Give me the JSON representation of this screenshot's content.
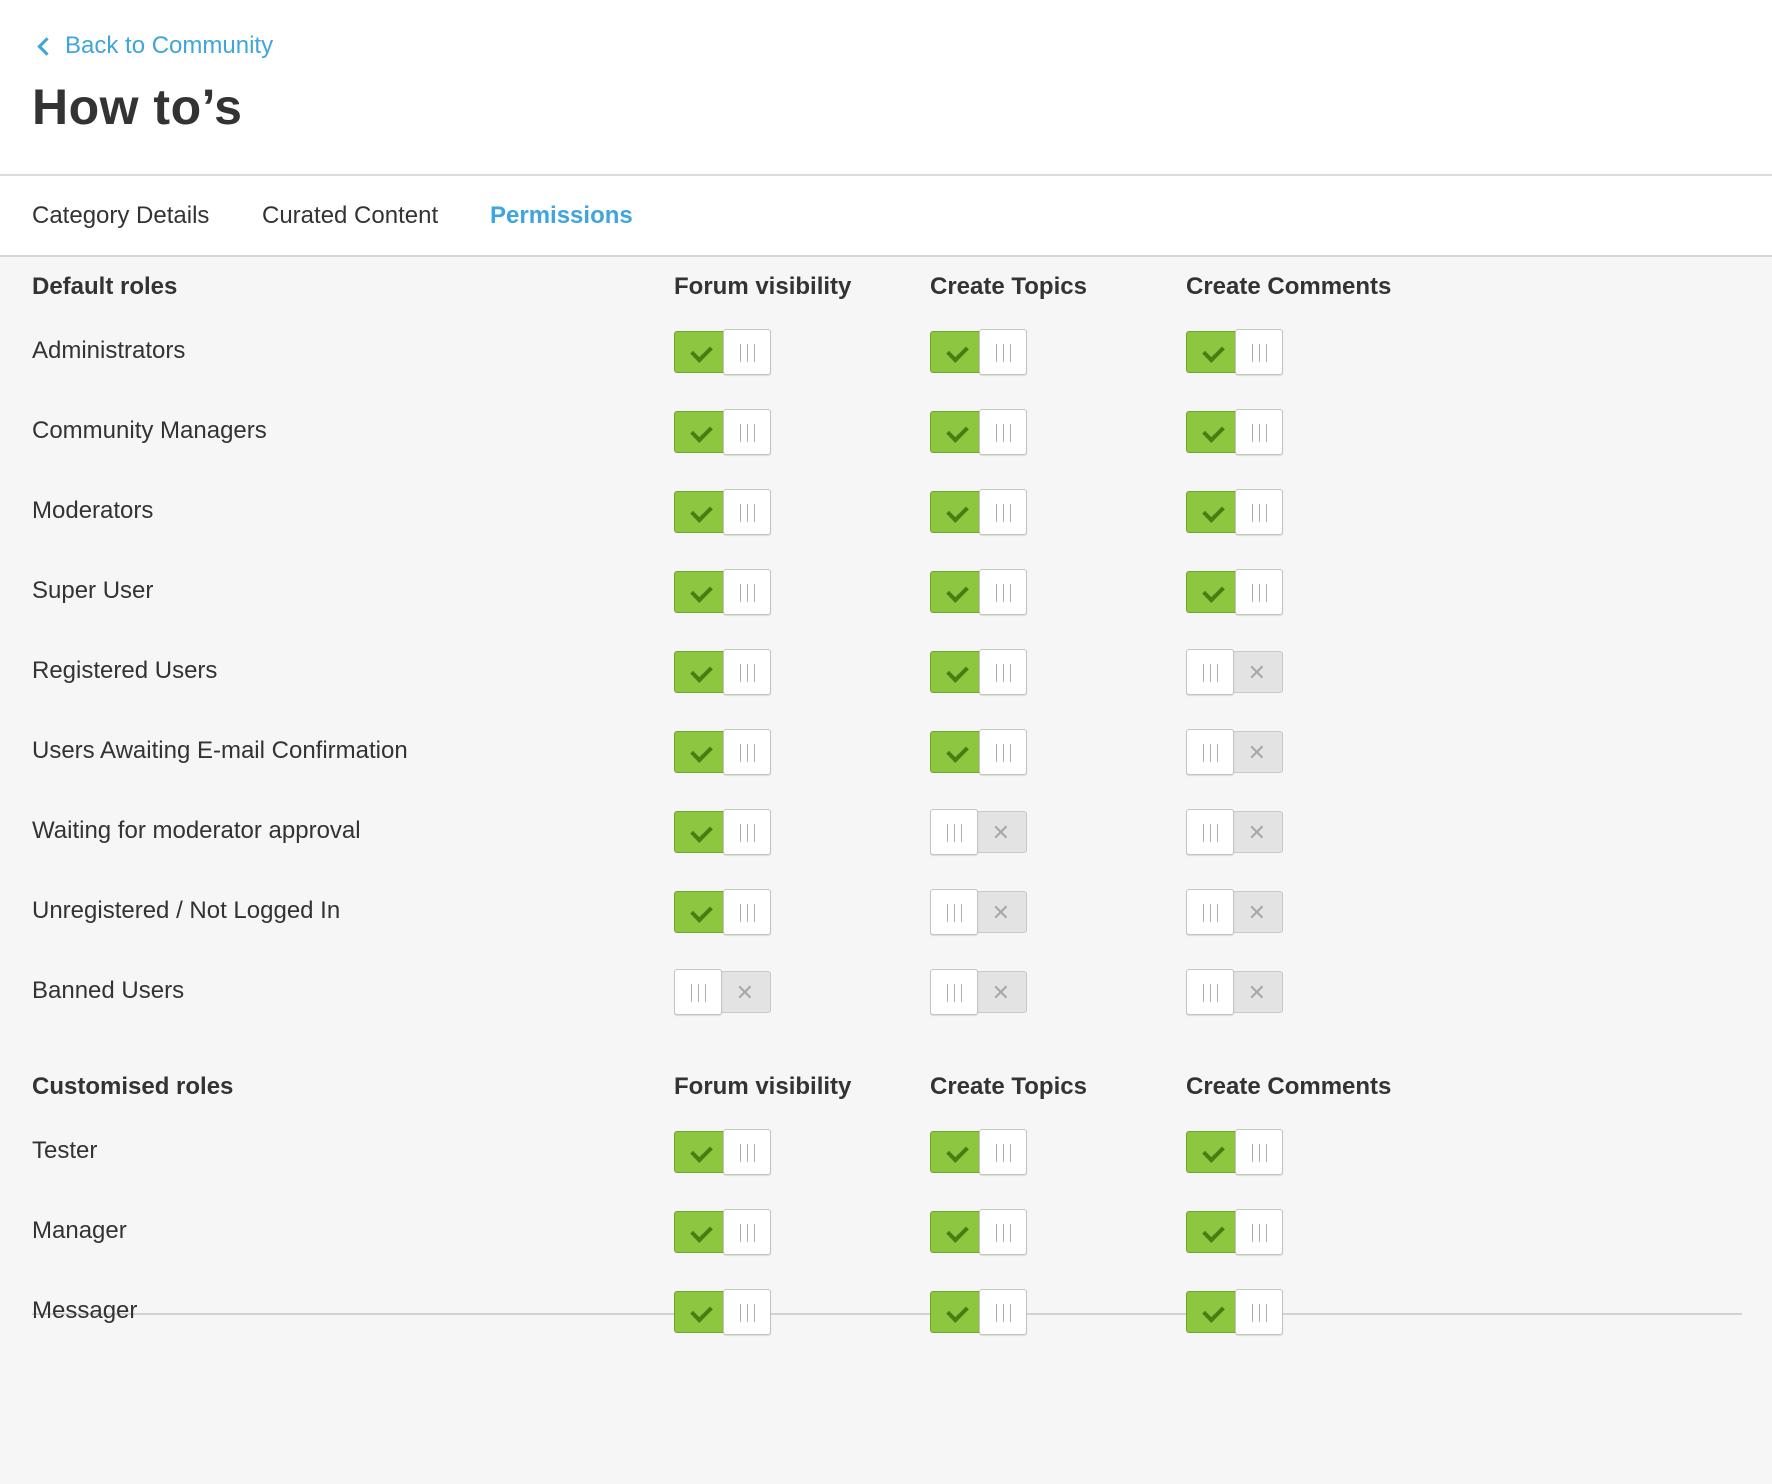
{
  "header": {
    "back_link": "Back to Community",
    "title": "How to’s"
  },
  "tabs": [
    {
      "label": "Category Details",
      "active": false
    },
    {
      "label": "Curated Content",
      "active": false
    },
    {
      "label": "Permissions",
      "active": true
    }
  ],
  "permission_columns": [
    "Forum visibility",
    "Create Topics",
    "Create Comments"
  ],
  "sections": [
    {
      "title": "Default roles",
      "roles": [
        {
          "name": "Administrators",
          "forum_visibility": true,
          "create_topics": true,
          "create_comments": true
        },
        {
          "name": "Community Managers",
          "forum_visibility": true,
          "create_topics": true,
          "create_comments": true
        },
        {
          "name": "Moderators",
          "forum_visibility": true,
          "create_topics": true,
          "create_comments": true
        },
        {
          "name": "Super User",
          "forum_visibility": true,
          "create_topics": true,
          "create_comments": true
        },
        {
          "name": "Registered Users",
          "forum_visibility": true,
          "create_topics": true,
          "create_comments": false
        },
        {
          "name": "Users Awaiting E-mail Confirmation",
          "forum_visibility": true,
          "create_topics": true,
          "create_comments": false
        },
        {
          "name": "Waiting for moderator approval",
          "forum_visibility": true,
          "create_topics": false,
          "create_comments": false
        },
        {
          "name": "Unregistered / Not Logged In",
          "forum_visibility": true,
          "create_topics": false,
          "create_comments": false
        },
        {
          "name": "Banned Users",
          "forum_visibility": false,
          "create_topics": false,
          "create_comments": false
        }
      ]
    },
    {
      "title": "Customised roles",
      "roles": [
        {
          "name": "Tester",
          "forum_visibility": true,
          "create_topics": true,
          "create_comments": true
        },
        {
          "name": "Manager",
          "forum_visibility": true,
          "create_topics": true,
          "create_comments": true
        },
        {
          "name": "Messager",
          "forum_visibility": true,
          "create_topics": true,
          "create_comments": true
        }
      ]
    }
  ],
  "colors": {
    "accent": "#3fa5dc",
    "toggle_on": "#8dc63f",
    "toggle_off": "#e3e3e3"
  }
}
